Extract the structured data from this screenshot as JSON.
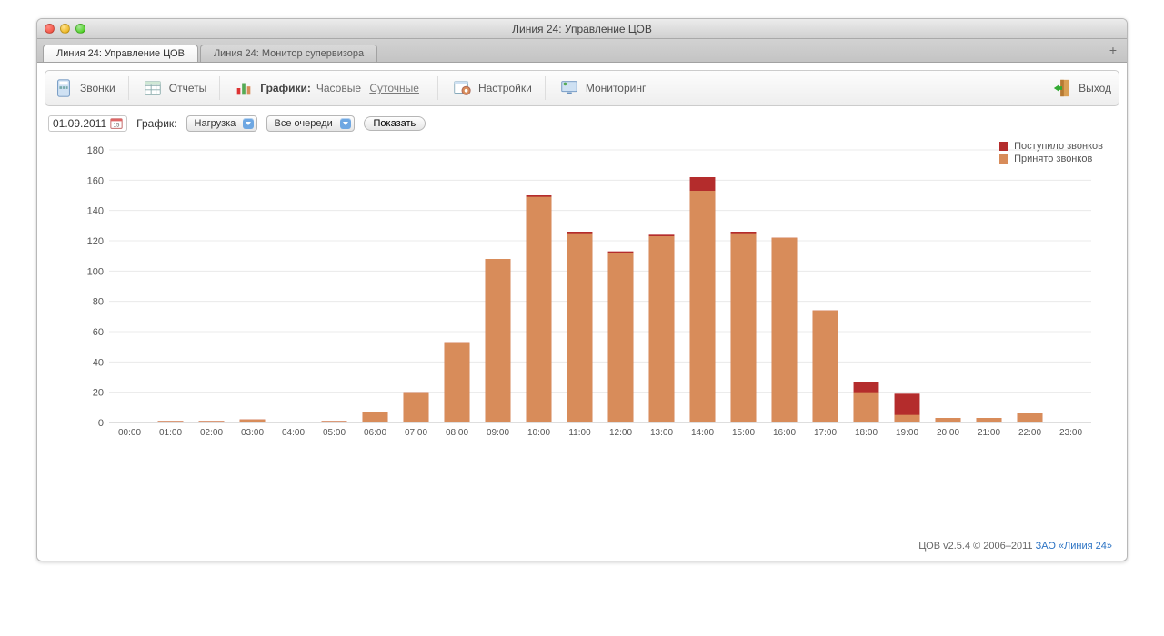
{
  "window_title": "Линия 24: Управление ЦОВ",
  "tabs": [
    {
      "label": "Линия 24: Управление ЦОВ",
      "active": true
    },
    {
      "label": "Линия 24: Монитор супервизора",
      "active": false
    }
  ],
  "toolbar": {
    "calls": "Звонки",
    "reports": "Отчеты",
    "charts": "Графики:",
    "charts_sub_hourly": "Часовые",
    "charts_sub_daily": "Суточные",
    "settings": "Настройки",
    "monitoring": "Мониторинг",
    "exit": "Выход"
  },
  "filters": {
    "date": "01.09.2011",
    "label": "График:",
    "chart_select": "Нагрузка",
    "queue_select": "Все очереди",
    "show_btn": "Показать"
  },
  "legend": {
    "a": "Поступило звонков",
    "b": "Принято звонков"
  },
  "footer": {
    "text": "ЦОВ v2.5.4 © 2006–2011 ",
    "link": "ЗАО «Линия 24»"
  },
  "chart_data": {
    "type": "bar",
    "xlabel": "",
    "ylabel": "",
    "ylim": [
      0,
      180
    ],
    "yticks": [
      0,
      20,
      40,
      60,
      80,
      100,
      120,
      140,
      160,
      180
    ],
    "categories": [
      "00:00",
      "01:00",
      "02:00",
      "03:00",
      "04:00",
      "05:00",
      "06:00",
      "07:00",
      "08:00",
      "09:00",
      "10:00",
      "11:00",
      "12:00",
      "13:00",
      "14:00",
      "15:00",
      "16:00",
      "17:00",
      "18:00",
      "19:00",
      "20:00",
      "21:00",
      "22:00",
      "23:00"
    ],
    "series": [
      {
        "name": "Поступило звонков",
        "color": "#b42c2c",
        "values": [
          0,
          1,
          1,
          2,
          0,
          1,
          7,
          20,
          53,
          108,
          150,
          126,
          113,
          124,
          162,
          126,
          122,
          74,
          27,
          19,
          3,
          3,
          6,
          0
        ]
      },
      {
        "name": "Принято звонков",
        "color": "#d88c5a",
        "values": [
          0,
          1,
          1,
          2,
          0,
          1,
          7,
          20,
          53,
          108,
          149,
          125,
          112,
          123,
          153,
          125,
          122,
          74,
          20,
          5,
          3,
          3,
          6,
          0
        ]
      }
    ]
  }
}
